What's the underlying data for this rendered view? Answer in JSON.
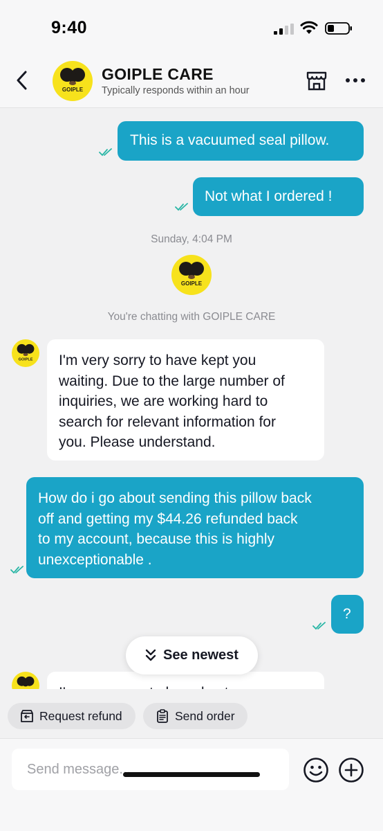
{
  "status_bar": {
    "time": "9:40"
  },
  "header": {
    "title": "GOIPLE CARE",
    "subtitle": "Typically responds within an hour",
    "logo_text": "GOIPLE"
  },
  "messages": {
    "m1": "This is a vacuumed seal pillow.",
    "m2": "Not what I ordered !",
    "timestamp": "Sunday, 4:04 PM",
    "system_note": "You're chatting with GOIPLE CARE",
    "m3_lines": [
      "I'm very sorry to have kept you",
      "waiting. Due to the large number of",
      "inquiries, we are working hard to",
      "search for relevant information for",
      "you. Please understand."
    ],
    "m4_lines": [
      "How do i go about sending this pillow back",
      "off and getting my $44.26 refunded back",
      "to my account, because this is highly",
      "unexceptionable ."
    ],
    "m5": "?",
    "m6_partial": "I'm very sorry to have kept you"
  },
  "see_newest": "See newest",
  "quick_actions": {
    "refund": "Request refund",
    "send_order": "Send order"
  },
  "composer": {
    "placeholder": "Send message..."
  },
  "colors": {
    "accent": "#1aa4c7",
    "brand_yellow": "#f7e21c",
    "read_check": "#2ab6a6"
  }
}
